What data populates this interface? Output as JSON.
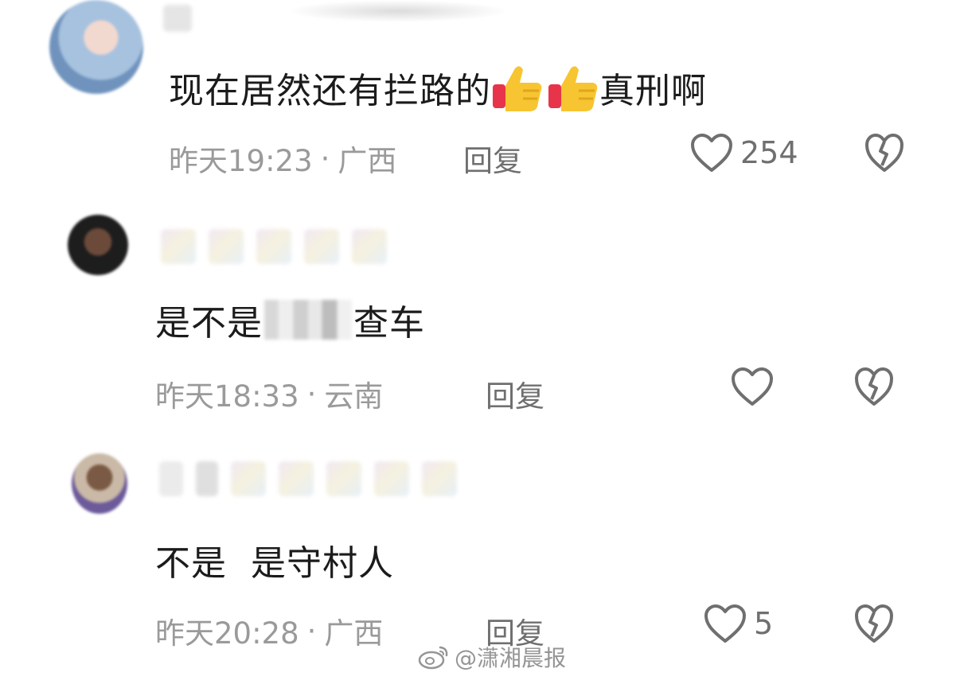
{
  "comments": [
    {
      "text_before": "现在居然还有拦路的",
      "text_after": "真刑啊",
      "emojis": [
        "thumbs-up-emoji",
        "thumbs-up-emoji"
      ],
      "time": "昨天19:23",
      "location": "广西",
      "reply_label": "回复",
      "like_count": "254"
    },
    {
      "text_before": "是不是",
      "text_after": "查车",
      "time": "昨天18:33",
      "location": "云南",
      "reply_label": "回复",
      "like_count": ""
    },
    {
      "text_before": "不是  是守村人",
      "time": "昨天20:28",
      "location": "广西",
      "reply_label": "回复",
      "like_count": "5"
    }
  ],
  "separator": "·",
  "watermark": "@潇湘晨报",
  "icons": {
    "like": "heart-outline-icon",
    "dislike": "broken-heart-icon",
    "watermark": "weibo-icon"
  },
  "colors": {
    "text": "#1b1b1b",
    "meta": "#9a9a9a",
    "icon": "#6f6f6f"
  }
}
